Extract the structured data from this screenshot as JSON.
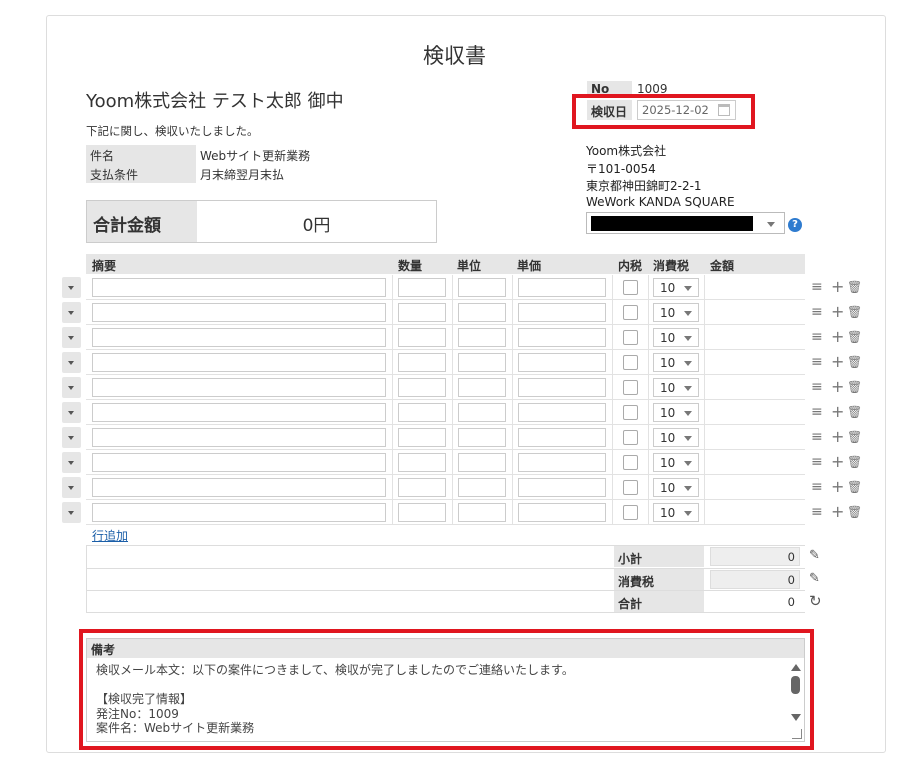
{
  "title": "検収書",
  "recipient": "Yoom株式会社 テスト太郎 御中",
  "lead_text": "下記に関し、検収いたしました。",
  "subject": {
    "label": "件名",
    "value": "Webサイト更新業務"
  },
  "payment_terms": {
    "label": "支払条件",
    "value": "月末締翌月末払"
  },
  "total_amount": {
    "label": "合計金額",
    "value": "0円"
  },
  "no": {
    "label": "No",
    "value": "1009"
  },
  "inspection_date": {
    "label": "検収日",
    "value": "2025-12-02"
  },
  "issuer": {
    "company": "Yoom株式会社",
    "postal": "〒101-0054",
    "address1": "東京都神田錦町2-2-1",
    "address2": "WeWork KANDA SQUARE",
    "help": "?"
  },
  "grid": {
    "headers": {
      "description": "摘要",
      "quantity": "数量",
      "unit": "単位",
      "unit_price": "単価",
      "tax_included": "内税",
      "tax_rate": "消費税",
      "amount": "金額"
    },
    "rows": [
      {
        "tax_rate": "10"
      },
      {
        "tax_rate": "10"
      },
      {
        "tax_rate": "10"
      },
      {
        "tax_rate": "10"
      },
      {
        "tax_rate": "10"
      },
      {
        "tax_rate": "10"
      },
      {
        "tax_rate": "10"
      },
      {
        "tax_rate": "10"
      },
      {
        "tax_rate": "10"
      },
      {
        "tax_rate": "10"
      }
    ],
    "add_row": "行追加"
  },
  "summary": {
    "subtotal": {
      "label": "小計",
      "value": "0"
    },
    "tax": {
      "label": "消費税",
      "value": "0"
    },
    "total": {
      "label": "合計",
      "value": "0"
    }
  },
  "notes": {
    "label": "備考",
    "text": "検収メール本文：以下の案件につきまして、検収が完了しましたのでご連絡いたします。\n\n【検収完了情報】\n発注No：1009\n案件名：Webサイト更新業務"
  },
  "colors": {
    "highlight": "#e0161f",
    "link": "#1a5ea8",
    "label_bg": "#e6e6e6"
  }
}
